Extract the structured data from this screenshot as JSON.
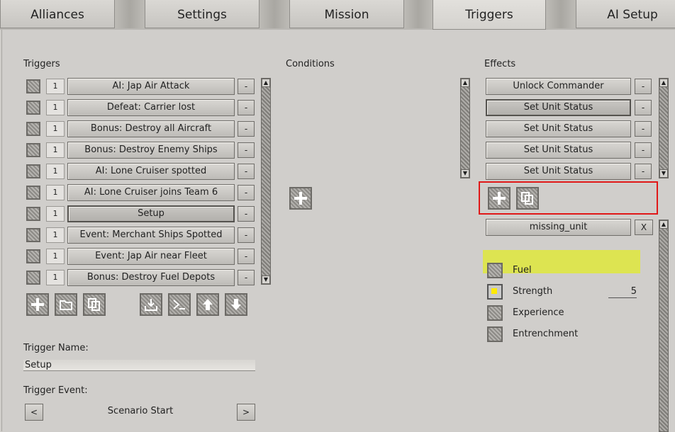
{
  "tabs": [
    {
      "label": "Alliances"
    },
    {
      "label": "Settings"
    },
    {
      "label": "Mission"
    },
    {
      "label": "Triggers"
    },
    {
      "label": "AI Setup"
    }
  ],
  "active_tab": "Triggers",
  "triggers": {
    "heading": "Triggers",
    "items": [
      {
        "count": "1",
        "label": "AI: Jap Air Attack",
        "remove": "-"
      },
      {
        "count": "1",
        "label": "Defeat: Carrier lost",
        "remove": "-"
      },
      {
        "count": "1",
        "label": "Bonus: Destroy all Aircraft",
        "remove": "-"
      },
      {
        "count": "1",
        "label": "Bonus: Destroy Enemy Ships",
        "remove": "-"
      },
      {
        "count": "1",
        "label": "AI: Lone Cruiser spotted",
        "remove": "-"
      },
      {
        "count": "1",
        "label": "AI: Lone Cruiser joins Team 6",
        "remove": "-"
      },
      {
        "count": "1",
        "label": "Setup",
        "remove": "-",
        "selected": true
      },
      {
        "count": "1",
        "label": "Event: Merchant Ships Spotted",
        "remove": "-"
      },
      {
        "count": "1",
        "label": "Event: Jap Air near Fleet",
        "remove": "-"
      },
      {
        "count": "1",
        "label": "Bonus: Destroy Fuel Depots",
        "remove": "-"
      }
    ],
    "toolbar_icons": [
      "add-icon",
      "folder-icon",
      "copy-icon",
      "import-icon",
      "console-icon",
      "arrow-up-icon",
      "arrow-down-icon"
    ]
  },
  "trigger_name": {
    "label": "Trigger Name:",
    "value": "Setup"
  },
  "trigger_event": {
    "label": "Trigger Event:",
    "value": "Scenario Start",
    "prev": "<",
    "next": ">"
  },
  "conditions": {
    "heading": "Conditions"
  },
  "effects": {
    "heading": "Effects",
    "items": [
      {
        "label": "Unlock Commander",
        "remove": "-"
      },
      {
        "label": "Set Unit Status",
        "remove": "-",
        "selected": true
      },
      {
        "label": "Set Unit Status",
        "remove": "-"
      },
      {
        "label": "Set Unit Status",
        "remove": "-"
      },
      {
        "label": "Set Unit Status",
        "remove": "-"
      }
    ],
    "unit": {
      "value": "missing_unit",
      "clear": "X"
    },
    "status_options": [
      {
        "label": "Fuel",
        "checked": false
      },
      {
        "label": "Strength",
        "checked": true,
        "value": "5"
      },
      {
        "label": "Experience",
        "checked": false
      },
      {
        "label": "Entrenchment",
        "checked": false
      }
    ]
  },
  "colors": {
    "highlight_red": "#e01818",
    "highlight_yellow": "#e1eb28",
    "check_on": "#ffea00"
  }
}
